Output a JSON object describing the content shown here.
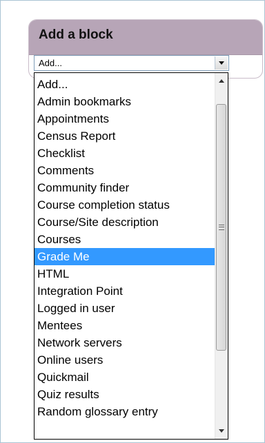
{
  "block": {
    "title": "Add a block",
    "select_value": "Add..."
  },
  "dropdown": {
    "options": [
      "Add...",
      "Admin bookmarks",
      "Appointments",
      "Census Report",
      "Checklist",
      "Comments",
      "Community finder",
      "Course completion status",
      "Course/Site description",
      "Courses",
      "Grade Me",
      "HTML",
      "Integration Point",
      "Logged in user",
      "Mentees",
      "Network servers",
      "Online users",
      "Quickmail",
      "Quiz results",
      "Random glossary entry"
    ],
    "selected_option": "Grade Me",
    "highlight_color": "#3399ff"
  },
  "colors": {
    "header_background": "#b7a5b7",
    "frame_border": "#a9c4d4"
  },
  "icons": {
    "select_arrow": "chevron-down-icon",
    "scroll_up": "scroll-up-arrow-icon",
    "scroll_down": "scroll-down-arrow-icon",
    "scroll_grip": "grip-lines-icon"
  }
}
